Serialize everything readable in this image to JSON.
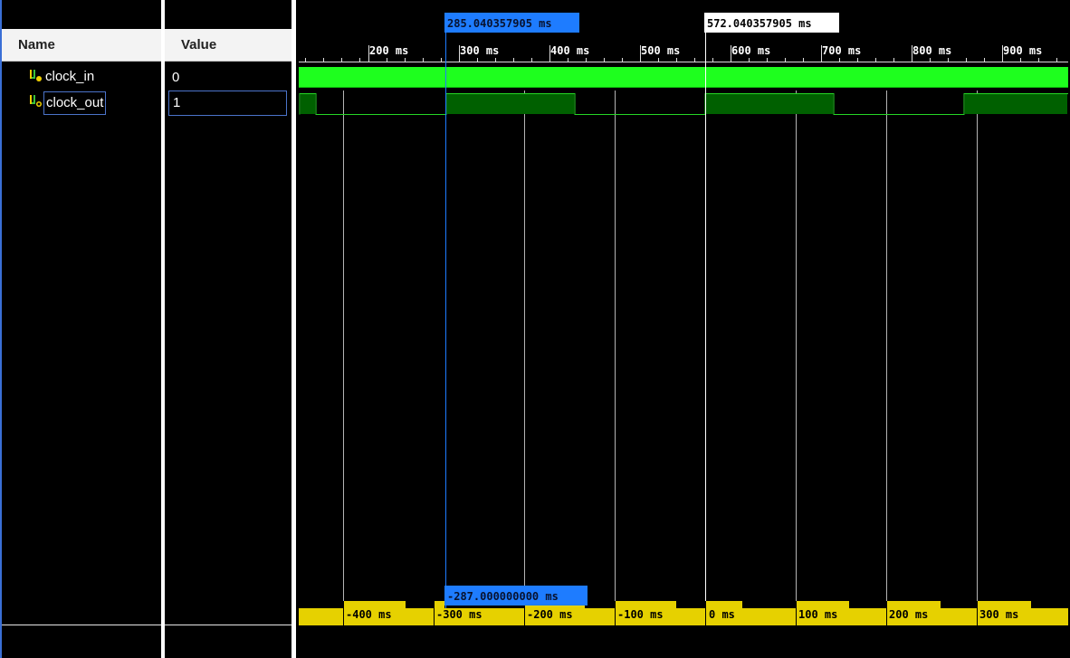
{
  "columns": {
    "name": "Name",
    "value": "Value"
  },
  "signals": [
    {
      "name": "clock_in",
      "value": "0",
      "icon": "bus-signal-icon",
      "selected": false
    },
    {
      "name": "clock_out",
      "value": "1",
      "icon": "bus-signal-icon",
      "selected": true
    }
  ],
  "cursors": {
    "main": "285.040357905 ms",
    "secondary": "572.040357905 ms",
    "delta": "-287.000000000 ms"
  },
  "time_axis": {
    "unit": "ms",
    "labels": [
      "200 ms",
      "300 ms",
      "400 ms",
      "500 ms",
      "600 ms",
      "700 ms",
      "800 ms",
      "900 ms"
    ]
  },
  "relative_axis": {
    "labels": [
      "-400 ms",
      "-300 ms",
      "-200 ms",
      "-100 ms",
      "0 ms",
      "100 ms",
      "200 ms",
      "300 ms"
    ]
  },
  "colors": {
    "clock_in_wave": "#1eff1e",
    "clock_out_wave": "#006000",
    "cursor_main": "#1e7cff",
    "relative_bar": "#e6d100",
    "background": "#000000"
  }
}
